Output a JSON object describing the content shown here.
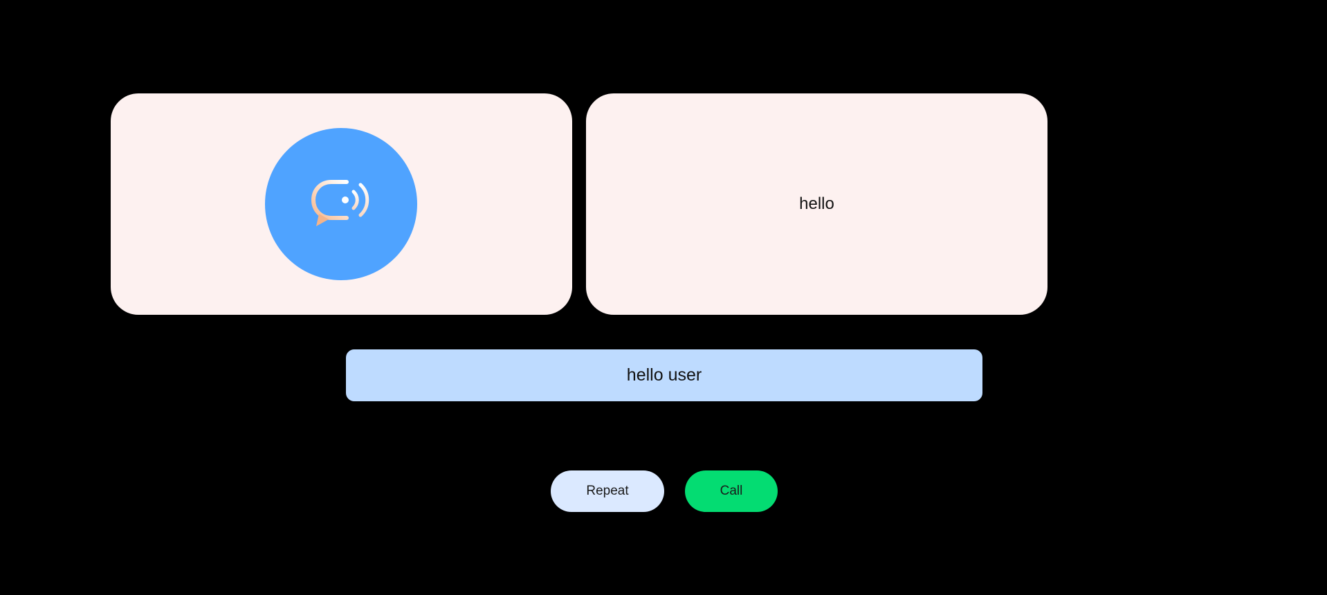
{
  "assistant_panel": {
    "icon": "chat-voice-icon",
    "avatar_color": "#4fa3ff"
  },
  "user_panel": {
    "message": "hello"
  },
  "response_banner": {
    "text": "hello user",
    "color": "#bedbff"
  },
  "actions": {
    "repeat_label": "Repeat",
    "call_label": "Call",
    "repeat_color": "#dbe9ff",
    "call_color": "#04dc72"
  },
  "colors": {
    "background": "#000000",
    "card": "#fdf1f0"
  }
}
